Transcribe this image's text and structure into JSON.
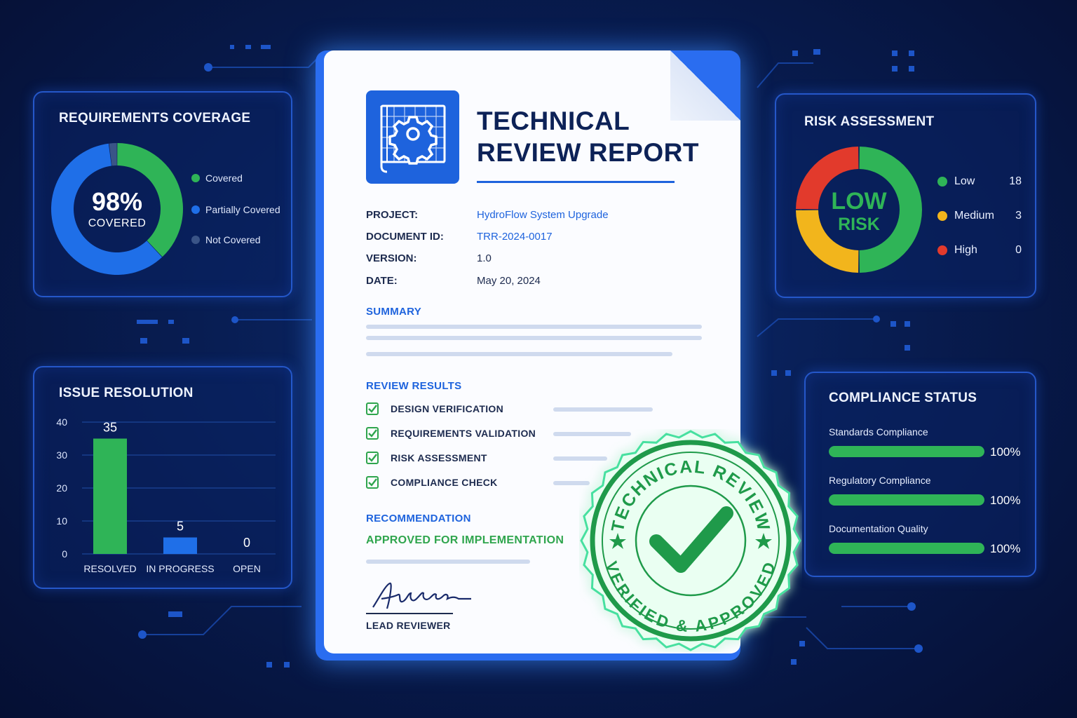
{
  "document": {
    "title_line1": "TECHNICAL",
    "title_line2": "REVIEW REPORT",
    "meta": [
      {
        "key": "PROJECT:",
        "value": "HydroFlow System Upgrade"
      },
      {
        "key": "DOCUMENT ID:",
        "value": "TRR-2024-0017"
      },
      {
        "key": "VERSION:",
        "value": "1.0"
      },
      {
        "key": "DATE:",
        "value": "May 20, 2024"
      }
    ],
    "summary_heading": "SUMMARY",
    "results_heading": "REVIEW RESULTS",
    "results": [
      {
        "label": "DESIGN VERIFICATION",
        "checked": true
      },
      {
        "label": "REQUIREMENTS VALIDATION",
        "checked": true
      },
      {
        "label": "RISK ASSESSMENT",
        "checked": true
      },
      {
        "label": "COMPLIANCE CHECK",
        "checked": true
      }
    ],
    "recommendation_heading": "RECOMMENDATION",
    "recommendation_value": "APPROVED FOR IMPLEMENTATION",
    "signature_text": "Andrews",
    "signer_label": "LEAD REVIEWER",
    "accent_color": "#1e63dd"
  },
  "seal": {
    "top_text": "TECHNICAL REVIEW",
    "bottom_text": "VERIFIED & APPROVED",
    "color": "#1f9a4a"
  },
  "coverage": {
    "title": "REQUIREMENTS COVERAGE",
    "center_value": "98%",
    "center_label": "COVERED",
    "legend": [
      {
        "label": "Covered",
        "color": "#2fb457"
      },
      {
        "label": "Partially Covered",
        "color": "#1f6fe8"
      },
      {
        "label": "Not Covered",
        "color": "#3a5487"
      }
    ],
    "chart_data": {
      "type": "pie",
      "categories": [
        "Covered",
        "Partially Covered",
        "Not Covered"
      ],
      "values": [
        38,
        60,
        2
      ]
    }
  },
  "risk": {
    "title": "RISK ASSESSMENT",
    "center_line1": "LOW",
    "center_line2": "RISK",
    "rows": [
      {
        "label": "Low",
        "value": "18",
        "color": "#2fb457"
      },
      {
        "label": "Medium",
        "value": "3",
        "color": "#f2b51c"
      },
      {
        "label": "High",
        "value": "0",
        "color": "#e23a2c"
      }
    ],
    "chart_data": {
      "type": "pie",
      "categories": [
        "Low",
        "Medium",
        "High"
      ],
      "values": [
        50,
        25,
        25
      ]
    }
  },
  "issues": {
    "title": "ISSUE RESOLUTION",
    "chart_data": {
      "type": "bar",
      "categories": [
        "RESOLVED",
        "IN PROGRESS",
        "OPEN"
      ],
      "values": [
        35,
        5,
        0
      ],
      "data_labels": [
        "35",
        "5",
        "0"
      ],
      "colors": [
        "#2fb457",
        "#1f6fe8",
        "#1f6fe8"
      ],
      "ylim": [
        0,
        40
      ],
      "yticks": [
        "0",
        "10",
        "20",
        "30",
        "40"
      ],
      "grid": true
    }
  },
  "compliance": {
    "title": "COMPLIANCE STATUS",
    "items": [
      {
        "label": "Standards Compliance",
        "value": "100%",
        "fraction": 1.0
      },
      {
        "label": "Regulatory Compliance",
        "value": "100%",
        "fraction": 1.0
      },
      {
        "label": "Documentation Quality",
        "value": "100%",
        "fraction": 1.0
      }
    ]
  }
}
